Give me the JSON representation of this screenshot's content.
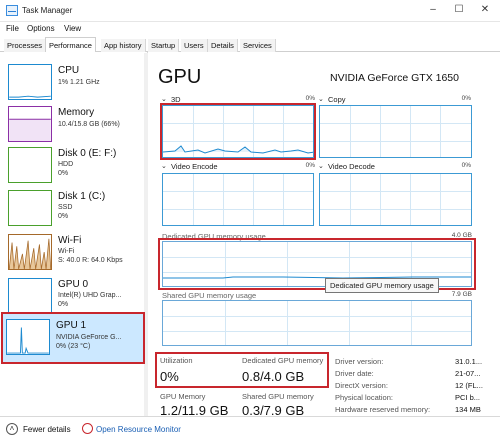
{
  "window": {
    "title": "Task Manager",
    "controls": [
      "–",
      "☐",
      "✕"
    ]
  },
  "menu": {
    "items": [
      "File",
      "Options",
      "View"
    ]
  },
  "tabs": [
    "Processes",
    "Performance",
    "App history",
    "Startup",
    "Users",
    "Details",
    "Services"
  ],
  "active_tab": "Performance",
  "sidebar": {
    "items": [
      {
        "title": "CPU",
        "line1": "1% 1.21 GHz",
        "line2": "",
        "line3": "",
        "color": "#1d8ad0"
      },
      {
        "title": "Memory",
        "line1": "10.4/15.8 GB (66%)",
        "line2": "",
        "line3": "",
        "color": "#8b2fa6"
      },
      {
        "title": "Disk 0 (E: F:)",
        "line1": "HDD",
        "line2": "0%",
        "line3": "",
        "color": "#4aa02c"
      },
      {
        "title": "Disk 1 (C:)",
        "line1": "SSD",
        "line2": "0%",
        "line3": "",
        "color": "#4aa02c"
      },
      {
        "title": "Wi-Fi",
        "line1": "Wi-Fi",
        "line2": "S: 40.0  R: 64.0 Kbps",
        "line3": "",
        "color": "#a5692a"
      },
      {
        "title": "GPU 0",
        "line1": "Intel(R) UHD Grap...",
        "line2": "0%",
        "line3": "",
        "color": "#1d8ad0"
      },
      {
        "title": "GPU 1",
        "line1": "NVIDIA GeForce G...",
        "line2": "0% (23 °C)",
        "line3": "",
        "color": "#1d8ad0"
      }
    ]
  },
  "main": {
    "title": "GPU",
    "adapter_name": "NVIDIA GeForce GTX 1650",
    "engines": [
      {
        "label": "3D",
        "pct": "0%"
      },
      {
        "label": "Copy",
        "pct": "0%"
      },
      {
        "label": "Video Encode",
        "pct": "0%"
      },
      {
        "label": "Video Decode",
        "pct": "0%"
      }
    ],
    "dedicated_memory": {
      "label": "Dedicated GPU memory usage",
      "max": "4.0 GB"
    },
    "shared_memory": {
      "label": "Shared GPU memory usage",
      "max": "7.9 GB"
    },
    "tooltip": "Dedicated GPU memory usage",
    "stats": {
      "utilization_label": "Utilization",
      "utilization_value": "0%",
      "dedicated_label": "Dedicated GPU memory",
      "dedicated_value": "0.8/4.0 GB",
      "gpu_memory_label": "GPU Memory",
      "gpu_memory_value": "1.2/11.9 GB",
      "shared_label": "Shared GPU memory",
      "shared_value": "0.3/7.9 GB"
    },
    "info": [
      {
        "label": "Driver version:",
        "value": "31.0.1..."
      },
      {
        "label": "Driver date:",
        "value": "21-07..."
      },
      {
        "label": "DirectX version:",
        "value": "12 (FL..."
      },
      {
        "label": "Physical location:",
        "value": "PCI b..."
      },
      {
        "label": "Hardware reserved memory:",
        "value": "134 MB"
      }
    ]
  },
  "footer": {
    "fewer_details": "Fewer details",
    "open_monitor": "Open Resource Monitor"
  },
  "colors": {
    "graph_line": "#1d8ad0",
    "highlight": "#c8262d",
    "selected_bg": "#cce8ff"
  }
}
